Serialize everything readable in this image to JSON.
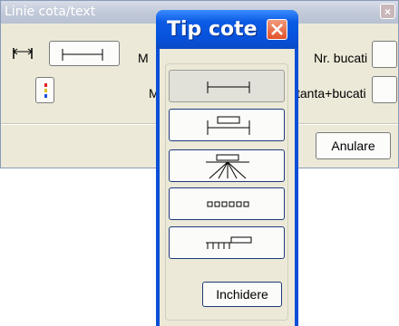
{
  "background_dialog": {
    "title": "Linie cota/text",
    "close_glyph": "×",
    "label_nr_bucati": "Nr. bucati",
    "label_distanta_bucati": "stanta+bucati",
    "label_partial_1": "M",
    "label_partial_2": "M",
    "cancel_label": "Anulare"
  },
  "dialog": {
    "title": "Tip cote",
    "close_glyph": "×",
    "buttons": [
      {
        "icon": "linear-dimension-icon"
      },
      {
        "icon": "dimension-with-text-box-icon"
      },
      {
        "icon": "radial-dimension-with-text-icon"
      },
      {
        "icon": "dotted-pieces-icon"
      },
      {
        "icon": "comb-with-text-icon"
      }
    ],
    "close_label": "Inchidere"
  },
  "colors": {
    "titlebar_blue": "#0c5be4",
    "close_red": "#e2512a",
    "dialog_face": "#ece9d8"
  }
}
